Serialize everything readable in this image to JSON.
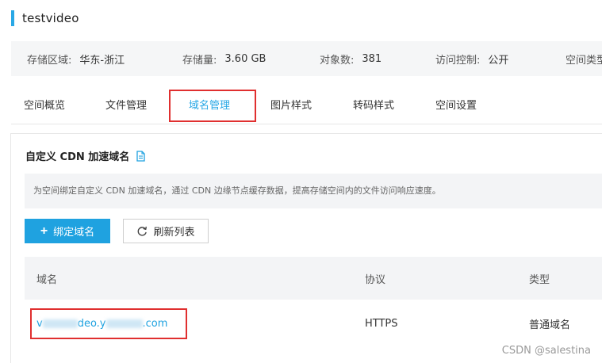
{
  "bucket": {
    "name": "testvideo",
    "accent_color": "#29a8e6"
  },
  "info": {
    "region_label": "存储区域:",
    "region_value": "华东-浙江",
    "storage_label": "存储量:",
    "storage_value": "3.60 GB",
    "objects_label": "对象数:",
    "objects_value": "381",
    "access_label": "访问控制:",
    "access_value": "公开",
    "type_label": "空间类型"
  },
  "tabs": [
    {
      "label": "空间概览",
      "active": false
    },
    {
      "label": "文件管理",
      "active": false
    },
    {
      "label": "域名管理",
      "active": true
    },
    {
      "label": "图片样式",
      "active": false
    },
    {
      "label": "转码样式",
      "active": false
    },
    {
      "label": "空间设置",
      "active": false
    }
  ],
  "cdn": {
    "section_title": "自定义 CDN 加速域名",
    "doc_icon": "doc-icon",
    "notice": "为空间绑定自定义 CDN 加速域名，通过 CDN 边缘节点缓存数据，提高存储空间内的文件访问响应速度。",
    "bind_button": "绑定域名",
    "refresh_button": "刷新列表",
    "primary_color": "#1fa2e0"
  },
  "table": {
    "columns": [
      "域名",
      "协议",
      "类型"
    ],
    "rows": [
      {
        "domain_start": "v",
        "domain_mid": "deo.y",
        "domain_end": ".com",
        "protocol": "HTTPS",
        "type": "普通域名"
      }
    ]
  },
  "highlight_color": "#e02f2f",
  "watermark": "CSDN @salestina"
}
